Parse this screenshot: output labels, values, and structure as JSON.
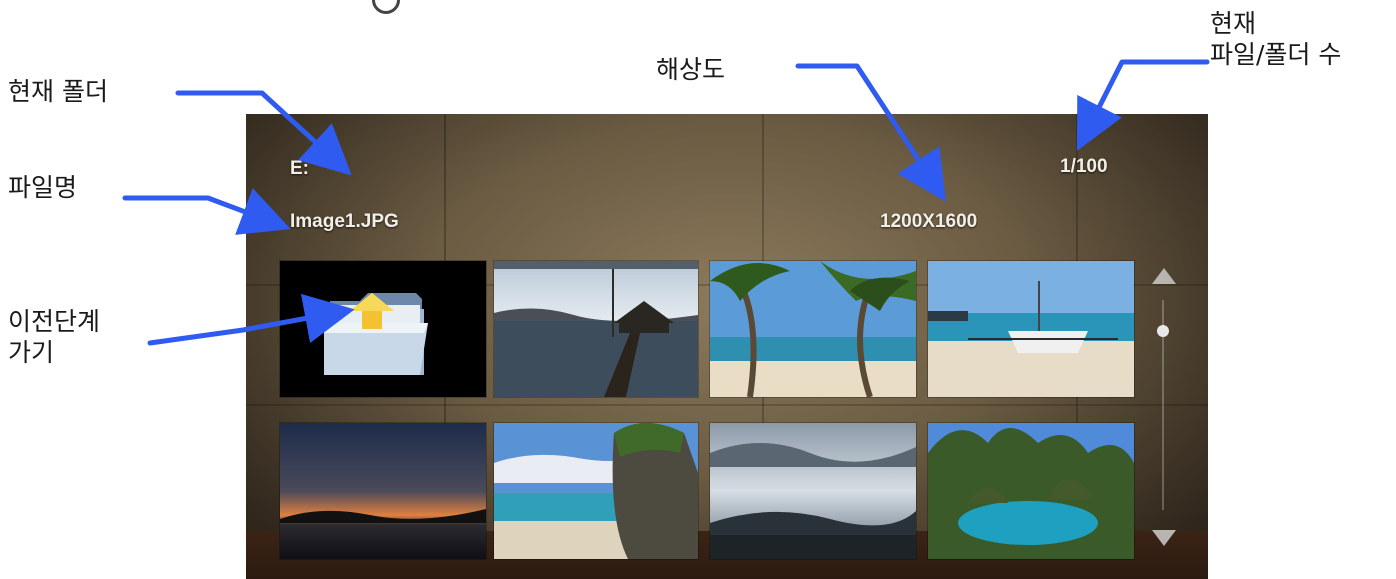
{
  "annotations": {
    "current_folder": "현재  폴더",
    "file_name": "파일명",
    "go_up": "이전단계\n가기",
    "resolution": "해상도",
    "current_count": "현재\n파일/폴더 수",
    "arrow_color": "#2f5bf0"
  },
  "viewer": {
    "folder": "E:",
    "file_name": "Image1.JPG",
    "resolution": "1200X1600",
    "position": "1/100"
  },
  "thumbnails": [
    {
      "kind": "parent-folder-icon"
    },
    {
      "kind": "pier-photo"
    },
    {
      "kind": "palm-beach-photo"
    },
    {
      "kind": "boat-beach-photo"
    },
    {
      "kind": "sunset-photo"
    },
    {
      "kind": "cliff-beach-photo"
    },
    {
      "kind": "cloudy-bay-photo"
    },
    {
      "kind": "lagoon-photo"
    }
  ]
}
